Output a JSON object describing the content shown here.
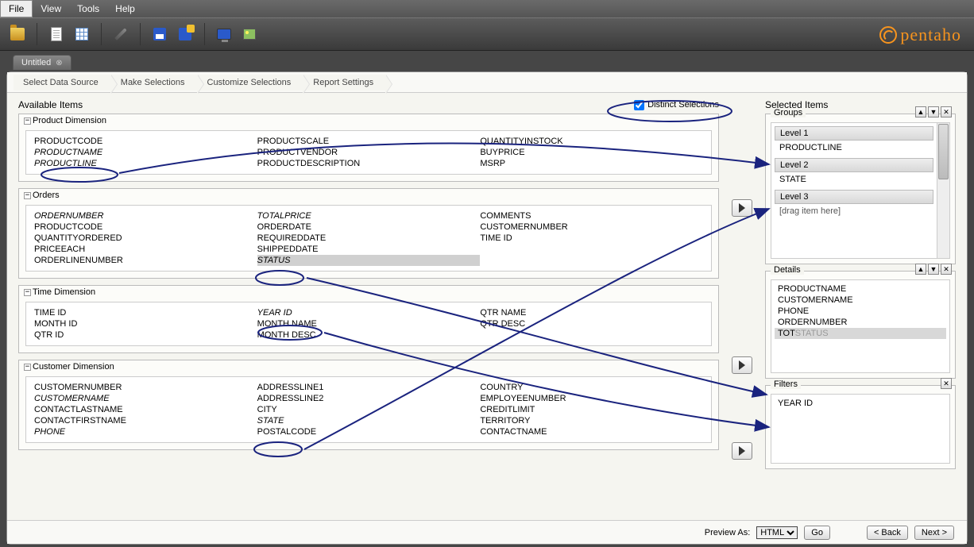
{
  "menu": {
    "file": "File",
    "view": "View",
    "tools": "Tools",
    "help": "Help"
  },
  "brand": "pentaho",
  "tab": {
    "title": "Untitled"
  },
  "breadcrumb": [
    "Select Data Source",
    "Make Selections",
    "Customize Selections",
    "Report Settings"
  ],
  "available": {
    "title": "Available Items",
    "distinct_label": "Distinct Selections",
    "groups": [
      {
        "name": "Product Dimension",
        "cols": [
          [
            "PRODUCTCODE",
            "PRODUCTNAME",
            "PRODUCTLINE"
          ],
          [
            "PRODUCTSCALE",
            "PRODUCTVENDOR",
            "PRODUCTDESCRIPTION"
          ],
          [
            "QUANTITYINSTOCK",
            "BUYPRICE",
            "MSRP"
          ]
        ],
        "italic": [
          "PRODUCTNAME",
          "PRODUCTLINE"
        ]
      },
      {
        "name": "Orders",
        "cols": [
          [
            "ORDERNUMBER",
            "PRODUCTCODE",
            "QUANTITYORDERED",
            "PRICEEACH",
            "ORDERLINENUMBER"
          ],
          [
            "TOTALPRICE",
            "ORDERDATE",
            "REQUIREDDATE",
            "SHIPPEDDATE",
            "STATUS"
          ],
          [
            "COMMENTS",
            "CUSTOMERNUMBER",
            "TIME ID",
            "",
            ""
          ]
        ],
        "italic": [
          "ORDERNUMBER",
          "TOTALPRICE",
          "STATUS"
        ],
        "selected": [
          "STATUS"
        ]
      },
      {
        "name": "Time Dimension",
        "cols": [
          [
            "TIME ID",
            "MONTH ID",
            "QTR ID"
          ],
          [
            "YEAR ID",
            "MONTH NAME",
            "MONTH DESC"
          ],
          [
            "QTR NAME",
            "QTR DESC",
            ""
          ]
        ],
        "italic": [
          "YEAR ID"
        ]
      },
      {
        "name": "Customer Dimension",
        "cols": [
          [
            "CUSTOMERNUMBER",
            "CUSTOMERNAME",
            "CONTACTLASTNAME",
            "CONTACTFIRSTNAME",
            "PHONE"
          ],
          [
            "ADDRESSLINE1",
            "ADDRESSLINE2",
            "CITY",
            "STATE",
            "POSTALCODE"
          ],
          [
            "COUNTRY",
            "EMPLOYEENUMBER",
            "CREDITLIMIT",
            "TERRITORY",
            "CONTACTNAME"
          ]
        ],
        "italic": [
          "CUSTOMERNAME",
          "PHONE",
          "STATE"
        ]
      }
    ]
  },
  "selected": {
    "title": "Selected Items",
    "groups": {
      "title": "Groups",
      "levels": [
        {
          "label": "Level 1",
          "item": "PRODUCTLINE"
        },
        {
          "label": "Level 2",
          "item": "STATE"
        },
        {
          "label": "Level 3",
          "item": "[drag item here]",
          "placeholder": true
        }
      ]
    },
    "details": {
      "title": "Details",
      "items": [
        "PRODUCTNAME",
        "CUSTOMERNAME",
        "PHONE",
        "ORDERNUMBER",
        "TOTALPRICE"
      ],
      "ghost": "STATUS",
      "selected": "TOTALPRICE"
    },
    "filters": {
      "title": "Filters",
      "items": [
        "YEAR ID"
      ]
    }
  },
  "footer": {
    "preview_label": "Preview As:",
    "preview_value": "HTML",
    "go": "Go",
    "back": "< Back",
    "next": "Next >"
  }
}
